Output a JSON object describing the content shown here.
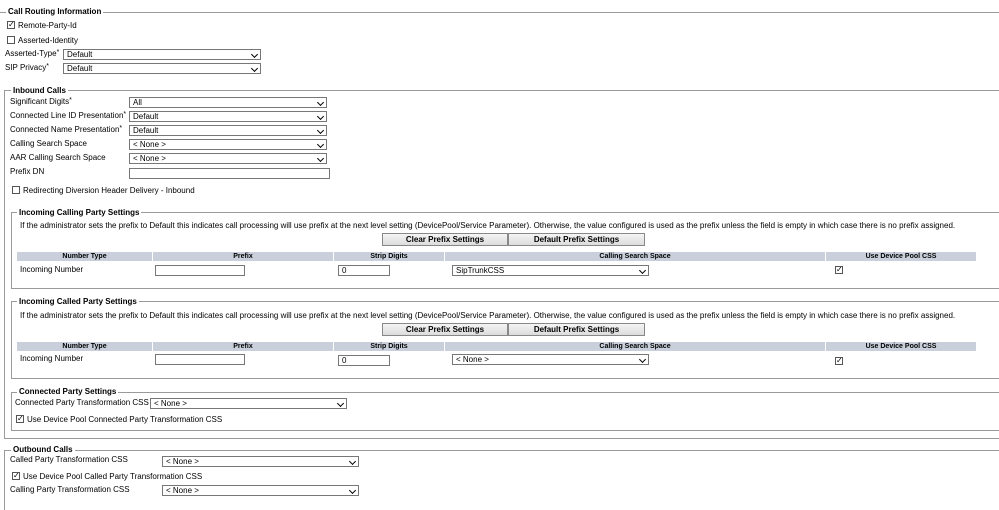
{
  "call_routing": {
    "legend": "Call Routing Information",
    "remote_party_id": {
      "label": "Remote-Party-Id",
      "checked": true
    },
    "asserted_identity": {
      "label": "Asserted-Identity",
      "checked": false
    },
    "asserted_type": {
      "label": "Asserted-Type",
      "value": "Default"
    },
    "sip_privacy": {
      "label": "SIP Privacy",
      "value": "Default"
    }
  },
  "inbound": {
    "legend": "Inbound Calls",
    "significant_digits": {
      "label": "Significant Digits",
      "value": "All"
    },
    "connected_line_id": {
      "label": "Connected Line ID Presentation",
      "value": "Default"
    },
    "connected_name": {
      "label": "Connected Name Presentation",
      "value": "Default"
    },
    "calling_search_space": {
      "label": "Calling Search Space",
      "value": "< None >"
    },
    "aar_css": {
      "label": "AAR Calling Search Space",
      "value": "< None >"
    },
    "prefix_dn": {
      "label": "Prefix DN",
      "value": ""
    },
    "redirecting": {
      "label": "Redirecting Diversion Header Delivery - Inbound",
      "checked": false
    }
  },
  "required_marker": "*",
  "incoming_calling": {
    "legend": "Incoming Calling Party Settings",
    "note": "If the administrator sets the prefix to Default this indicates call processing will use prefix at the next level setting (DevicePool/Service Parameter). Otherwise, the value configured is used as the prefix unless the field is empty in which case there is no prefix assigned.",
    "clear_btn": "Clear Prefix Settings",
    "default_btn": "Default Prefix Settings",
    "headers": [
      "Number Type",
      "Prefix",
      "Strip Digits",
      "Calling Search Space",
      "Use Device Pool CSS"
    ],
    "row": {
      "number_type": "Incoming Number",
      "prefix": "",
      "strip": "0",
      "css": "SipTrunkCSS",
      "use_pool": true
    }
  },
  "incoming_called": {
    "legend": "Incoming Called Party Settings",
    "note": "If the administrator sets the prefix to Default this indicates call processing will use prefix at the next level setting (DevicePool/Service Parameter). Otherwise, the value configured is used as the prefix unless the field is empty in which case there is no prefix assigned.",
    "clear_btn": "Clear Prefix Settings",
    "default_btn": "Default Prefix Settings",
    "headers": [
      "Number Type",
      "Prefix",
      "Strip Digits",
      "Calling Search Space",
      "Use Device Pool CSS"
    ],
    "row": {
      "number_type": "Incoming Number",
      "prefix": "",
      "strip": "0",
      "css": "< None >",
      "use_pool": true
    }
  },
  "connected_party": {
    "legend": "Connected Party Settings",
    "transform_css": {
      "label": "Connected Party Transformation CSS",
      "value": "< None >"
    },
    "use_pool": {
      "label": "Use Device Pool Connected Party Transformation CSS",
      "checked": true
    }
  },
  "outbound": {
    "legend": "Outbound Calls",
    "called_css": {
      "label": "Called Party Transformation CSS",
      "value": "< None >"
    },
    "use_pool_called": {
      "label": "Use Device Pool Called Party Transformation CSS",
      "checked": true
    },
    "calling_css": {
      "label": "Calling Party Transformation CSS",
      "value": "< None >"
    }
  }
}
